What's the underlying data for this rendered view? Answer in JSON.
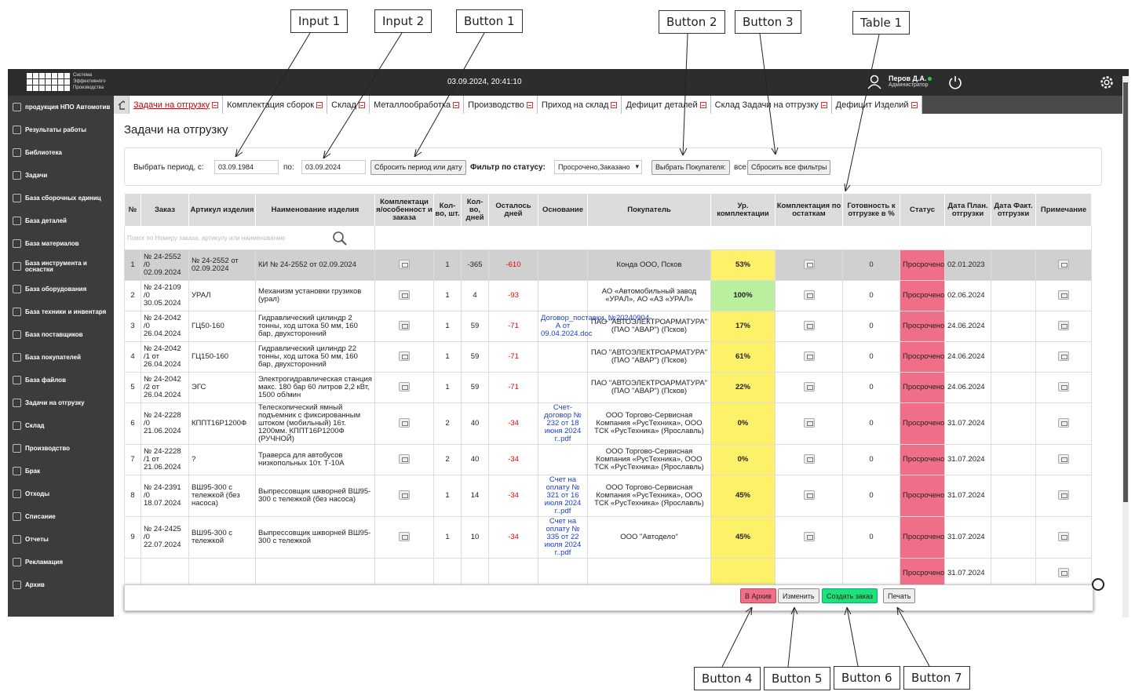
{
  "callouts": [
    "Input 1",
    "Input 2",
    "Button 1",
    "Button 2",
    "Button 3",
    "Table 1",
    "Button 4",
    "Button 5",
    "Button 6",
    "Button 7"
  ],
  "app": {
    "logo": [
      "Система",
      "Эффективного",
      "Производства"
    ],
    "datetime": "03.09.2024, 20:41:10",
    "user_name": "Перов Д.А.",
    "user_role": "Администратор"
  },
  "sidebar": [
    "продукция НПО Автомотив",
    "Результаты работы",
    "Библиотека",
    "Задачи",
    "База сборочных единиц",
    "База деталей",
    "База материалов",
    "База инструмента и оснастки",
    "База оборудования",
    "База техники и инвентаря",
    "База поставщиков",
    "База покупателей",
    "База файлов",
    "Задачи на отгрузку",
    "Склад",
    "Производство",
    "Брак",
    "Отходы",
    "Списание",
    "Отчеты",
    "Рекламация",
    "Архив"
  ],
  "tabs": [
    "Задачи на отгрузку",
    "Комплектация сборок",
    "Склад",
    "Металлообработка",
    "Производство",
    "Приход на склад",
    "Дефицит деталей",
    "Склад Задачи на отгрузку",
    "Дефицит Изделий"
  ],
  "page_title": "Задачи на отгрузку",
  "filter": {
    "period_label": "Выбрать период, с:",
    "from": "03.09.1984",
    "to_label": "по:",
    "to": "03.09.2024",
    "reset_period": "Сбросить период или дату",
    "status_label": "Фильтр по статусу:",
    "status_value": "Просрочено,Заказано",
    "choose_buyer": "Выбрать Покупателя:",
    "all_label": "все",
    "reset_all": "Сбросить все фильтры"
  },
  "search_placeholder": "Поиск по Номеру заказа, артикулу или наименованию",
  "columns": [
    "№",
    "Заказ",
    "Артикул изделия",
    "Наименование изделия",
    "Комплектаци я/особенност и заказа",
    "Кол-во, шт.",
    "Кол-во, дней",
    "Осталось дней",
    "Основание",
    "Покупатель",
    "Ур. комплектации",
    "Комплектация по остаткам",
    "Готовность к отгрузке в %",
    "Статус",
    "Дата План. отгрузки",
    "Дата Факт. отгрузки",
    "Примечание"
  ],
  "rows": [
    {
      "n": "1",
      "order": "№ 24-2552 /0 02.09.2024",
      "art": "№ 24-2552 от 02.09.2024",
      "name": "КИ № 24-2552 от 02.09.2024",
      "qty": "1",
      "days": "-365",
      "left": "-610",
      "base": "",
      "buyer": "Конда ООО, Псков",
      "lvl": "53%",
      "ready": "0",
      "status": "Просрочено",
      "plan": "02.01.2023"
    },
    {
      "n": "2",
      "order": "№ 24-2109 /0 30.05.2024",
      "art": "УРАЛ",
      "name": "Механизм установки грузиков (урал)",
      "qty": "1",
      "days": "4",
      "left": "-93",
      "base": "",
      "buyer": "АО «Автомобильный завод «УРАЛ», АО «АЗ «УРАЛ»",
      "lvl": "100%",
      "ready": "0",
      "status": "Просрочено",
      "plan": "02.06.2024"
    },
    {
      "n": "3",
      "order": "№ 24-2042 /0 26.04.2024",
      "art": "ГЦ50-160",
      "name": "Гидравлический цилиндр 2 тонны, ход штока 50 мм, 160 бар, двухсторонний",
      "qty": "1",
      "days": "59",
      "left": "-71",
      "base": "Договор_поставки_№20240904-А от 09.04.2024.doc",
      "buyer": "ПАО \"АВТОЭЛЕКТРОАРМАТУРА\" (ПАО \"АВАР\") (Псков)",
      "lvl": "17%",
      "ready": "0",
      "status": "Просрочено",
      "plan": "24.06.2024"
    },
    {
      "n": "4",
      "order": "№ 24-2042 /1 от 26.04.2024",
      "art": "ГЦ150-160",
      "name": "Гидравлический цилиндр 22 тонны, ход штока 50 мм, 160 бар, двухсторонний",
      "qty": "1",
      "days": "59",
      "left": "-71",
      "base": "",
      "buyer": "ПАО \"АВТОЭЛЕКТРОАРМАТУРА\" (ПАО \"АВАР\") (Псков)",
      "lvl": "61%",
      "ready": "0",
      "status": "Просрочено",
      "plan": "24.06.2024"
    },
    {
      "n": "5",
      "order": "№ 24-2042 /2 от 26.04.2024",
      "art": "ЭГС",
      "name": "Электрогидравлическая станция макс. 180 бар 60 литров 2,2 кВт, 1500 об/мин",
      "qty": "1",
      "days": "59",
      "left": "-71",
      "base": "",
      "buyer": "ПАО \"АВТОЭЛЕКТРОАРМАТУРА\" (ПАО \"АВАР\") (Псков)",
      "lvl": "22%",
      "ready": "0",
      "status": "Просрочено",
      "plan": "24.06.2024"
    },
    {
      "n": "6",
      "order": "№ 24-2228 /0 21.06.2024",
      "art": "КППТ16Р1200Ф",
      "name": "Телескопический ямный подъемник с фиксированным штоком (мобильный) 16т. 1200мм. КППТ16Р1200Ф (РУЧНОЙ)",
      "qty": "2",
      "days": "40",
      "left": "-34",
      "base": "Счет-договор № 232 от 18 июня 2024 г..pdf",
      "buyer": "ООО Торгово-Сервисная Компания «РусТехника», ООО ТСК «РусТехника» (Ярославль)",
      "lvl": "0%",
      "ready": "0",
      "status": "Просрочено",
      "plan": "31.07.2024"
    },
    {
      "n": "7",
      "order": "№ 24-2228 /1 от 21.06.2024",
      "art": "?",
      "name": "Траверса для автобусов низкопольных 10т. Т-10А",
      "qty": "2",
      "days": "40",
      "left": "-34",
      "base": "",
      "buyer": "ООО Торгово-Сервисная Компания «РусТехника», ООО ТСК «РусТехника» (Ярославль)",
      "lvl": "0%",
      "ready": "0",
      "status": "Просрочено",
      "plan": "31.07.2024"
    },
    {
      "n": "8",
      "order": "№ 24-2391 /0 18.07.2024",
      "art": "ВШ95-300 с тележкой (без насоса)",
      "name": "Выпрессовщик шкворней ВШ95-300 с тележкой (без насоса)",
      "qty": "1",
      "days": "14",
      "left": "-34",
      "base": "Счет на оплату № 321 от 16 июля 2024 г..pdf",
      "buyer": "ООО Торгово-Сервисная Компания «РусТехника», ООО ТСК «РусТехника» (Ярославль)",
      "lvl": "45%",
      "ready": "0",
      "status": "Просрочено",
      "plan": "31.07.2024"
    },
    {
      "n": "9",
      "order": "№ 24-2425 /0 22.07.2024",
      "art": "ВШ95-300 с тележкой",
      "name": "Выпрессовщик шкворней ВШ95-300 с тележкой",
      "qty": "1",
      "days": "10",
      "left": "-34",
      "base": "Счет на оплату № 335 от 22 июля 2024 г..pdf",
      "buyer": "ООО \"Автодело\"",
      "lvl": "45%",
      "ready": "0",
      "status": "Просрочено",
      "plan": "31.07.2024"
    },
    {
      "n": "",
      "order": "",
      "art": "",
      "name": "",
      "qty": "",
      "days": "",
      "left": "",
      "base": "",
      "buyer": "",
      "lvl": "",
      "ready": "",
      "status": "Просрочено",
      "plan": "31.07.2024"
    }
  ],
  "bottom_buttons": {
    "archive": "В Архив",
    "edit": "Изменить",
    "create": "Создать заказ",
    "print": "Печать"
  },
  "colors": {
    "yellow": "#fdf16a",
    "green": "#b9ef9f",
    "status": "#f06f88",
    "archive": "#f06f88",
    "create": "#1de27a"
  }
}
